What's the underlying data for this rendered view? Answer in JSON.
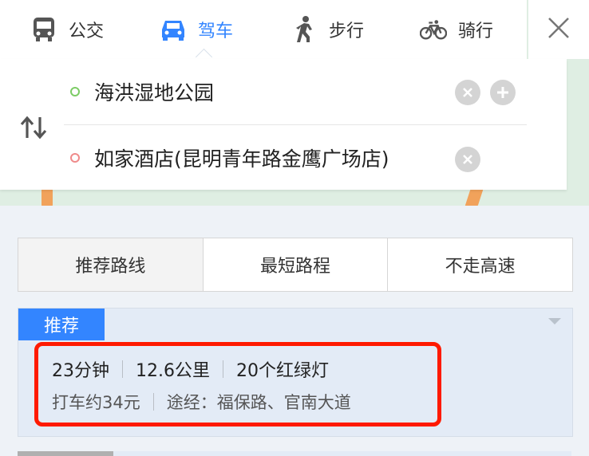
{
  "modes": {
    "bus": "公交",
    "drive": "驾车",
    "walk": "步行",
    "bike": "骑行"
  },
  "route": {
    "start": "海洪湿地公园",
    "end": "如家酒店(昆明青年路金鹰广场店)"
  },
  "route_tabs": {
    "recommended": "推荐路线",
    "shortest": "最短路程",
    "no_highway": "不走高速"
  },
  "result": {
    "badge": "推荐",
    "duration": "23分钟",
    "distance": "12.6公里",
    "lights": "20个红绿灯",
    "taxi": "打车约34元",
    "via": "途经：福保路、官南大道"
  },
  "colors": {
    "accent": "#3385ff",
    "highlight": "#ff1a00"
  }
}
